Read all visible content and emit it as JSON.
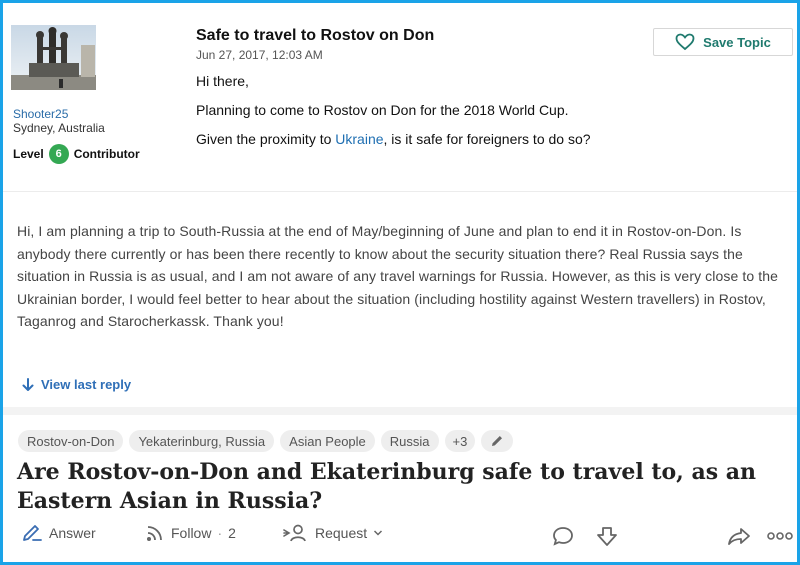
{
  "post": {
    "username": "Shooter25",
    "location": "Sydney, Australia",
    "level_label": "Level",
    "level_number": "6",
    "rank": "Contributor",
    "title": "Safe to travel to Rostov on Don",
    "date": "Jun 27, 2017, 12:03 AM",
    "greeting": "Hi there,",
    "line1": "Planning to come to Rostov on Don for the 2018 World Cup.",
    "line2_before": "Given the proximity to ",
    "line2_link": "Ukraine",
    "line2_after": ", is it safe for foreigners to do so?",
    "save_label": "Save Topic"
  },
  "reply": {
    "text": "Hi, I am planning a trip to South-Russia at the end of May/beginning of June and plan to end it in Rostov-on-Don. Is anybody there currently or has been there recently to know about the security situation there? Real Russia says the situation in Russia is as usual, and I am not aware of any travel warnings for Russia. However, as this is very close to the Ukrainian border, I would feel better to hear about the situation (including hostility against Western travellers) in Rostov, Taganrog and Starocherkassk. Thank you!",
    "view_last_reply": "View last reply"
  },
  "question": {
    "tags": [
      "Rostov-on-Don",
      "Yekaterinburg, Russia",
      "Asian People",
      "Russia"
    ],
    "more_tags": "+3",
    "title": "Are Rostov-on-Don and Ekaterinburg safe to travel to, as an Eastern Asian in Russia?",
    "answer_label": "Answer",
    "follow_label": "Follow",
    "follow_sep": "·",
    "follow_count": "2",
    "request_label": "Request"
  },
  "colors": {
    "frame_border": "#1aa3e8",
    "link": "#1f6fb2",
    "level_badge": "#34a853",
    "save_text": "#1f7a6e"
  },
  "icons": [
    "heart-icon",
    "arrow-down-icon",
    "pencil-icon",
    "answer-pen-icon",
    "follow-wifi-icon",
    "request-user-icon",
    "chevron-down-icon",
    "comment-icon",
    "downvote-icon",
    "share-icon",
    "more-icon"
  ]
}
